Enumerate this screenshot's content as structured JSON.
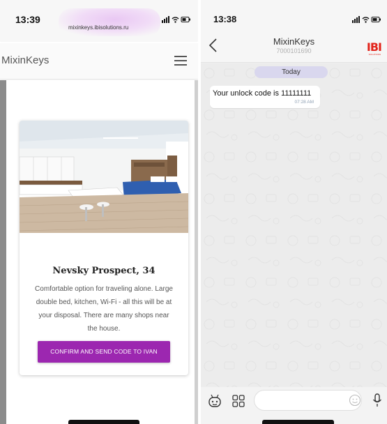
{
  "left_screen": {
    "status": {
      "time": "13:39",
      "url": "mixinkeys.ibisolutions.ru",
      "signal_icon": "signal-wifi-battery-icons"
    },
    "appbar": {
      "brand": "MixinKeys",
      "menu_icon": "hamburger-menu-icon"
    },
    "card": {
      "title": "Nevsky Prospect, 34",
      "description": "Comfortable option for traveling alone. Large double bed, kitchen, Wi-Fi - all this will be at your disposal. There are many shops near the house.",
      "button_label": "CONFIRM AND SEND CODE TO IVAN",
      "button_color": "#9c27b0"
    }
  },
  "right_screen": {
    "status": {
      "time": "13:38",
      "signal_icon": "signal-wifi-battery-icons"
    },
    "header": {
      "contact_name": "MixinKeys",
      "contact_phone": "7000101690",
      "logo": "IBI",
      "logo_sub": "SOLUTIONS"
    },
    "chat": {
      "date_label": "Today",
      "messages": [
        {
          "text": "Your unlock code is 11111111",
          "time": "07:28 AM"
        }
      ]
    },
    "input_bar": {
      "placeholder": ""
    }
  }
}
